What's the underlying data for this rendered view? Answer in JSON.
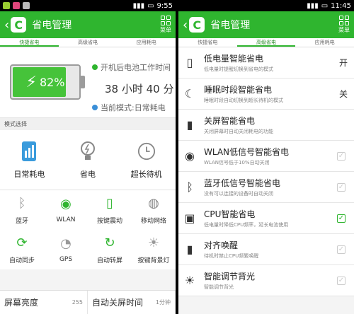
{
  "left": {
    "status": {
      "time": "9:55"
    },
    "title": "省电管理",
    "menu_label": "菜单",
    "tabs": [
      "快捷省电",
      "高级省电",
      "应用耗电"
    ],
    "battery": {
      "percent_label": "82%",
      "level": 0.82
    },
    "info": {
      "line1": "开机后电池工作时间",
      "duration": "38 小时 40 分",
      "line2": "当前模式:日常耗电"
    },
    "section_title": "模式选择",
    "modes": [
      "日常耗电",
      "省电",
      "超长待机"
    ],
    "toggles": [
      "蓝牙",
      "WLAN",
      "按键震动",
      "移动网络",
      "自动同步",
      "GPS",
      "自动转屏",
      "按键背景灯"
    ],
    "bottom": {
      "brightness_label": "屏幕亮度",
      "brightness_value": "255",
      "timeout_label": "自动关屏时间",
      "timeout_value": "1分钟"
    }
  },
  "right": {
    "status": {
      "time": "11:45"
    },
    "title": "省电管理",
    "menu_label": "菜单",
    "tabs": [
      "快捷省电",
      "高级省电",
      "应用耗电"
    ],
    "items": [
      {
        "title": "低电量智能省电",
        "desc": "低电量时提醒切换到省电的模式",
        "state": "开"
      },
      {
        "title": "睡眠时段智能省电",
        "desc": "睡眠时段自动切换到超长待机的模式",
        "state": "关"
      },
      {
        "title": "关屏智能省电",
        "desc": "关闭屏幕时自动关闭耗电的功能"
      },
      {
        "title": "WLAN低信号智能省电",
        "desc": "WLAN信号低于10%自动关闭"
      },
      {
        "title": "蓝牙低信号智能省电",
        "desc": "没有可以连接的设备时自动关闭"
      },
      {
        "title": "CPU智能省电",
        "desc": "低电量时降低CPU频率，延长电池使用"
      },
      {
        "title": "对齐唤醒",
        "desc": "待机时禁止CPU频繁唤醒"
      },
      {
        "title": "智能调节背光",
        "desc": "智能调节背光"
      }
    ],
    "checks": {
      "cpu": true
    }
  },
  "colors": {
    "accent": "#2fb52f",
    "battery_fill": "#46c33a"
  }
}
